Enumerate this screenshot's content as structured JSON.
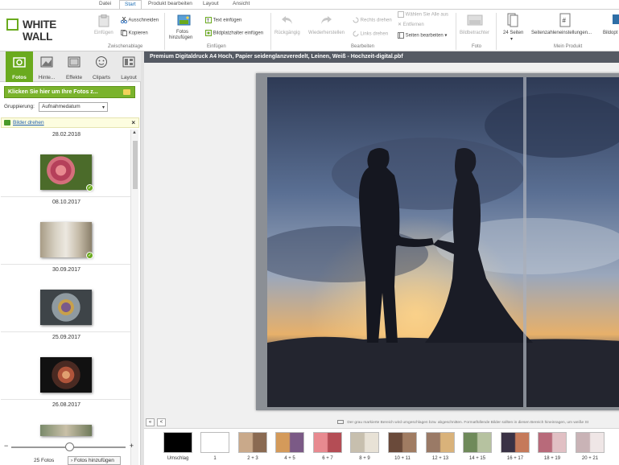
{
  "menu": {
    "tabs": [
      {
        "label": "Datei"
      },
      {
        "label": "Start"
      },
      {
        "label": "Produkt bearbeiten"
      },
      {
        "label": "Layout"
      },
      {
        "label": "Ansicht"
      }
    ],
    "active_tab": "Start"
  },
  "logo": {
    "text": "WHITE WALL"
  },
  "ribbon": {
    "clipboard": {
      "paste": "Einfügen",
      "cut": "Ausschneiden",
      "copy": "Kopieren",
      "group": "Zwischenablage"
    },
    "insert": {
      "add_photos_line1": "Fotos",
      "add_photos_line2": "hinzufügen",
      "insert_text": "Text einfügen",
      "insert_placeholder": "Bildplatzhalter einfügen",
      "group": "Einfügen"
    },
    "edit": {
      "undo": "Rückgängig",
      "redo": "Wiederherstellen",
      "rotate_right": "Rechts drehen",
      "rotate_left": "Links drehen",
      "select_all": "Wählen Sie Alle aus",
      "remove": "Entfernen",
      "edit_pages": "Seiten bearbeiten",
      "group": "Bearbeiten"
    },
    "photo": {
      "viewer": "Bildbetrachter",
      "group": "Foto"
    },
    "product": {
      "pages": "24 Seiten",
      "page_numbers": "Seitenzahleneinstellungen...",
      "image_options": "Bildopt",
      "group": "Mein Produkt"
    }
  },
  "left_panel": {
    "tabs": [
      {
        "label": "Fotos",
        "icon": "photos-icon"
      },
      {
        "label": "Hinte...",
        "icon": "background-icon"
      },
      {
        "label": "Effekte",
        "icon": "effects-icon"
      },
      {
        "label": "Cliparts",
        "icon": "cliparts-icon"
      },
      {
        "label": "Layout",
        "icon": "layout-icon"
      }
    ],
    "active_tab": "Fotos",
    "upload_button": "Klicken Sie hier um Ihre Fotos z...",
    "grouping_label": "Gruppierung:",
    "grouping_value": "Aufnahmedatum",
    "hint_link": "Bilder drehen",
    "hint_close": "×",
    "photo_groups": [
      {
        "date": "28.02.2018",
        "used": true
      },
      {
        "date": "08.10.2017",
        "used": true
      },
      {
        "date": "30.09.2017",
        "used": false
      },
      {
        "date": "25.09.2017",
        "used": false
      },
      {
        "date": "26.08.2017",
        "used": false
      }
    ],
    "zoom_minus": "−",
    "zoom_plus": "+",
    "zoom_level": 0.5,
    "photo_count": "25 Fotos",
    "add_photos_button": "Fotos hinzufügen"
  },
  "document": {
    "title": "Premium Digitaldruck A4 Hoch, Papier seidenglanzveredelt, Leinen, Weiß - Hochzeit-digital.pbf"
  },
  "canvas_bar": {
    "first_button": "«",
    "prev_button": "<",
    "note": "Der grau markierte Bereich wird umgeschlagen bzw. abgeschnitten. Formatfüllende Bilder sollten in diesen Bereich hineinragen, um weiße St"
  },
  "filmstrip": [
    {
      "label": "Umschlag",
      "color": "#000000"
    },
    {
      "label": "1",
      "color": "#ffffff"
    },
    {
      "label": "2 + 3",
      "color": "#8a6a52"
    },
    {
      "label": "4 + 5",
      "color": "#7b5a86"
    },
    {
      "label": "6 + 7",
      "color": "#b44d55"
    },
    {
      "label": "8 + 9",
      "color": "#c7bfae"
    },
    {
      "label": "10 + 11",
      "color": "#6a4a3a"
    },
    {
      "label": "12 + 13",
      "color": "#9a7a66"
    },
    {
      "label": "14 + 15",
      "color": "#6f8a5a"
    },
    {
      "label": "16 + 17",
      "color": "#3a3245"
    },
    {
      "label": "18 + 19",
      "color": "#b86a7a"
    },
    {
      "label": "20 + 21",
      "color": "#c9b3b6"
    }
  ],
  "colors": {
    "accent_green": "#6aaa1e",
    "title_bar": "#555a63"
  }
}
